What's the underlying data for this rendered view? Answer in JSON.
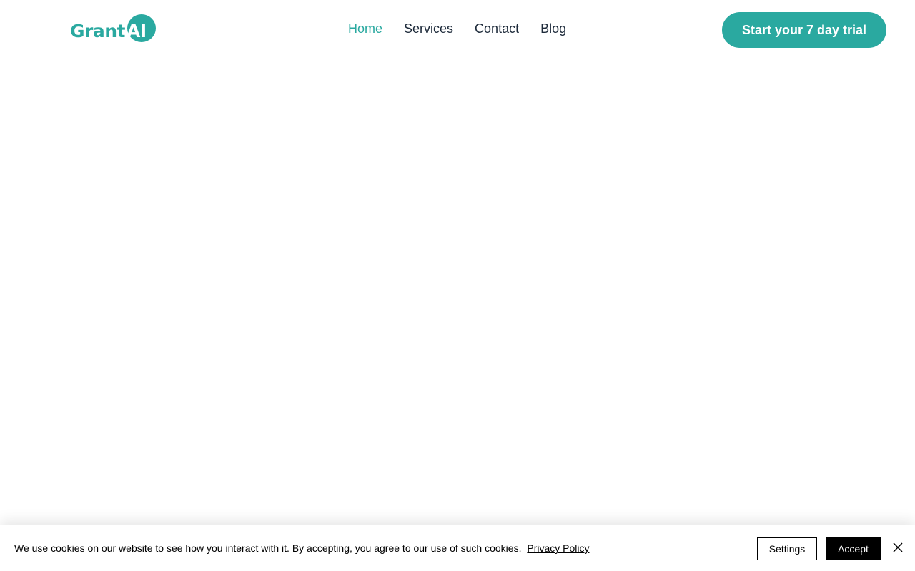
{
  "brand": {
    "logo_text_part1": "Grant",
    "logo_text_part2": "AI",
    "accent_color": "#2aa9a0"
  },
  "nav": {
    "items": [
      {
        "label": "Home",
        "active": true
      },
      {
        "label": "Services",
        "active": false
      },
      {
        "label": "Contact",
        "active": false
      },
      {
        "label": "Blog",
        "active": false
      }
    ]
  },
  "header": {
    "cta_label": "Start your 7 day trial"
  },
  "cookie_banner": {
    "message": "We use cookies on our website to see how you interact with it. By accepting, you agree to our use of such cookies.",
    "privacy_link_label": "Privacy Policy",
    "settings_label": "Settings",
    "accept_label": "Accept",
    "close_icon": "close-icon"
  }
}
